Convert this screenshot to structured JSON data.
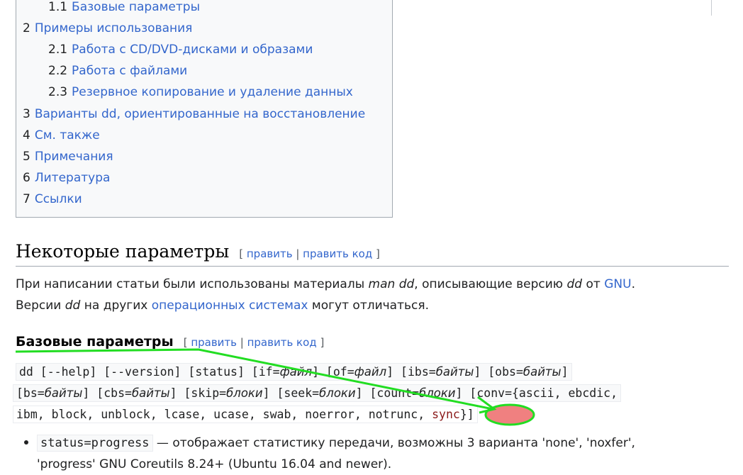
{
  "toc": [
    {
      "num": "1.1",
      "label": "Базовые параметры",
      "level": 2
    },
    {
      "num": "2",
      "label": "Примеры использования",
      "level": 1
    },
    {
      "num": "2.1",
      "label": "Работа с CD/DVD-дисками и образами",
      "level": 2
    },
    {
      "num": "2.2",
      "label": "Работа с файлами",
      "level": 2
    },
    {
      "num": "2.3",
      "label": "Резервное копирование и удаление данных",
      "level": 2
    },
    {
      "num": "3",
      "label": "Варианты dd, ориентированные на восстановление",
      "level": 1
    },
    {
      "num": "4",
      "label": "См. также",
      "level": 1
    },
    {
      "num": "5",
      "label": "Примечания",
      "level": 1
    },
    {
      "num": "6",
      "label": "Литература",
      "level": 1
    },
    {
      "num": "7",
      "label": "Ссылки",
      "level": 1
    }
  ],
  "section": {
    "title": "Некоторые параметры",
    "edit": "править",
    "edit_code": "править код"
  },
  "intro": {
    "t1": "При написании статьи были использованы материалы ",
    "i1": "man dd",
    "t2": ", описывающие версию ",
    "i2": "dd",
    "t3": " от ",
    "link1": "GNU",
    "t4": ".",
    "t5": "Версии ",
    "i3": "dd",
    "t6": " на других ",
    "link2": "операционных системах",
    "t7": " могут отличаться."
  },
  "subsection": {
    "title": "Базовые параметры",
    "edit": "править",
    "edit_code": "править код"
  },
  "code": {
    "l1a": "dd [--help] [--version] [status] [if=",
    "l1b": "файл",
    "l1c": "] [of=",
    "l1d": "файл",
    "l1e": "] [ibs=",
    "l1f": "байты",
    "l1g": "] [obs=",
    "l1h": "байты",
    "l1i": "]",
    "l2a": "[bs=",
    "l2b": "байты",
    "l2c": "] [cbs=",
    "l2d": "байты",
    "l2e": "] [skip=",
    "l2f": "блоки",
    "l2g": "] [seek=",
    "l2h": "блоки",
    "l2i": "] [count=",
    "l2j": "блоки",
    "l2k": "] [conv={ascii, ebcdic,",
    "l3a": "ibm, block, unblock, lcase, ucase, swab, noerror, notrunc, ",
    "l3b": "sync",
    "l3c": "}]"
  },
  "bullet": {
    "code": "status=progress",
    "text1": " — отображает статистику передачи, возможны 3 варианта 'none', 'noxfer',",
    "text2": "'progress' GNU Coreutils 8.24+ (Ubuntu 16.04 and newer)."
  },
  "annotation_color": "#22dd22",
  "highlight_color": "#f08080"
}
